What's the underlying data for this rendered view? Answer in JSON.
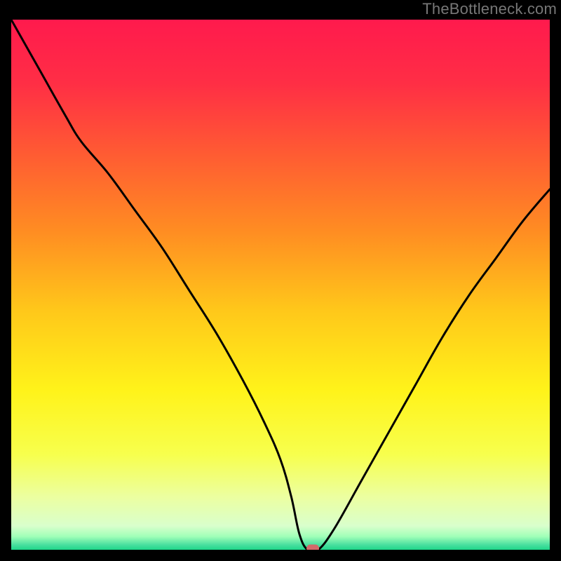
{
  "watermark": "TheBottleneck.com",
  "colors": {
    "frame": "#000000",
    "watermark": "#777777",
    "curve": "#000000",
    "marker": "#d46a6a",
    "gradient_stops": [
      {
        "offset": 0.0,
        "color": "#ff1a4d"
      },
      {
        "offset": 0.12,
        "color": "#ff2e45"
      },
      {
        "offset": 0.25,
        "color": "#ff5a33"
      },
      {
        "offset": 0.4,
        "color": "#ff8d22"
      },
      {
        "offset": 0.55,
        "color": "#ffc81a"
      },
      {
        "offset": 0.7,
        "color": "#fff31a"
      },
      {
        "offset": 0.82,
        "color": "#f7ff4d"
      },
      {
        "offset": 0.9,
        "color": "#ecffa0"
      },
      {
        "offset": 0.955,
        "color": "#d9ffcc"
      },
      {
        "offset": 0.975,
        "color": "#a0ffb8"
      },
      {
        "offset": 0.99,
        "color": "#4de0a0"
      },
      {
        "offset": 1.0,
        "color": "#1fd68a"
      }
    ]
  },
  "chart_data": {
    "type": "line",
    "title": "",
    "xlabel": "",
    "ylabel": "",
    "xlim": [
      0,
      100
    ],
    "ylim": [
      0,
      100
    ],
    "grid": false,
    "legend": false,
    "series": [
      {
        "name": "bottleneck-curve",
        "x": [
          0,
          5,
          10,
          13,
          18,
          23,
          28,
          33,
          38,
          43,
          47,
          50,
          52,
          53.5,
          55,
          57,
          60,
          65,
          70,
          75,
          80,
          85,
          90,
          95,
          100
        ],
        "values": [
          100,
          91,
          82,
          77,
          71,
          64,
          57,
          49,
          41,
          32,
          24,
          17,
          10,
          3,
          0,
          0,
          4,
          13,
          22,
          31,
          40,
          48,
          55,
          62,
          68
        ]
      }
    ],
    "marker": {
      "x": 56,
      "y": 0,
      "shape": "rounded-rect"
    }
  }
}
